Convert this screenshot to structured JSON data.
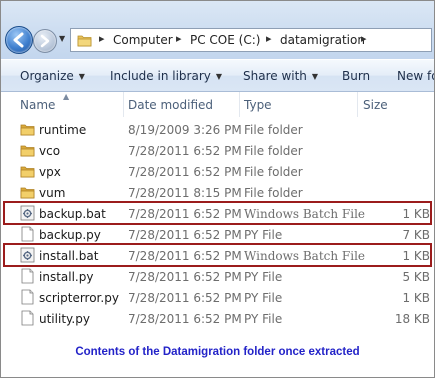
{
  "address_bar": {
    "crumbs": [
      "Computer",
      "PC COE (C:)",
      "datamigration"
    ],
    "icons": [
      "folder-icon"
    ]
  },
  "toolbar": {
    "organize": "Organize",
    "include_in_library": "Include in library",
    "share_with": "Share with",
    "burn": "Burn",
    "new_folder": "New fo"
  },
  "columns": {
    "name": "Name",
    "date_modified": "Date modified",
    "type": "Type",
    "size": "Size"
  },
  "files": [
    {
      "name": "runtime",
      "date": "8/19/2009 3:26 PM",
      "type": "File folder",
      "size": "",
      "kind": "folder"
    },
    {
      "name": "vco",
      "date": "7/28/2011 6:52 PM",
      "type": "File folder",
      "size": "",
      "kind": "folder"
    },
    {
      "name": "vpx",
      "date": "7/28/2011 6:52 PM",
      "type": "File folder",
      "size": "",
      "kind": "folder"
    },
    {
      "name": "vum",
      "date": "7/28/2011 8:15 PM",
      "type": "File folder",
      "size": "",
      "kind": "folder"
    },
    {
      "name": "backup.bat",
      "date": "7/28/2011 6:52 PM",
      "type": "Windows Batch File",
      "size": "1 KB",
      "kind": "batch",
      "highlighted": true
    },
    {
      "name": "backup.py",
      "date": "7/28/2011 6:52 PM",
      "type": "PY File",
      "size": "7 KB",
      "kind": "file"
    },
    {
      "name": "install.bat",
      "date": "7/28/2011 6:52 PM",
      "type": "Windows Batch File",
      "size": "1 KB",
      "kind": "batch",
      "highlighted": true
    },
    {
      "name": "install.py",
      "date": "7/28/2011 6:52 PM",
      "type": "PY File",
      "size": "5 KB",
      "kind": "file"
    },
    {
      "name": "scripterror.py",
      "date": "7/28/2011 6:52 PM",
      "type": "PY File",
      "size": "1 KB",
      "kind": "file"
    },
    {
      "name": "utility.py",
      "date": "7/28/2011 6:52 PM",
      "type": "PY File",
      "size": "18 KB",
      "kind": "file"
    }
  ],
  "caption": "Contents of the Datamigration folder once extracted",
  "colors": {
    "highlight_border": "#9b1c1c",
    "caption": "#2323c8",
    "folder": "#e8c15a"
  }
}
